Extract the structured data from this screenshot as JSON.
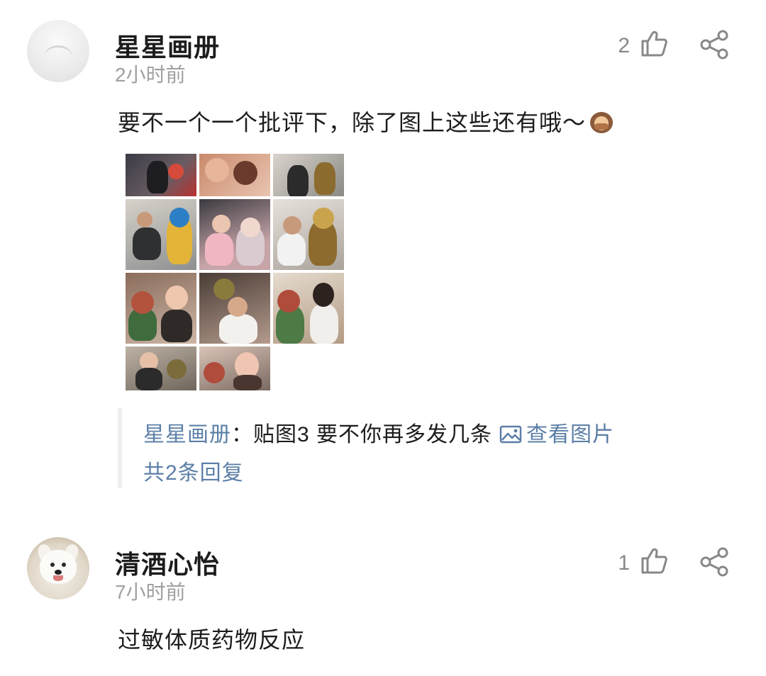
{
  "comments": [
    {
      "username": "星星画册",
      "time": "2小时前",
      "likes": "2",
      "text": "要不一个一个批评下，除了图上这些还有哦～",
      "emoji": "see-no-evil-monkey",
      "images": [
        {
          "icon": "photo-thumbnail"
        },
        {
          "icon": "photo-thumbnail"
        },
        {
          "icon": "photo-thumbnail"
        },
        {
          "icon": "photo-thumbnail"
        },
        {
          "icon": "photo-thumbnail"
        },
        {
          "icon": "photo-thumbnail"
        },
        {
          "icon": "photo-thumbnail"
        },
        {
          "icon": "photo-thumbnail"
        },
        {
          "icon": "photo-thumbnail"
        },
        {
          "icon": "photo-thumbnail"
        },
        {
          "icon": "photo-thumbnail"
        }
      ],
      "reply": {
        "author": "星星画册",
        "separator": "：",
        "text": "贴图3 要不你再多发几条",
        "view_image": "查看图片",
        "reply_count": "共2条回复"
      }
    },
    {
      "username": "清酒心怡",
      "time": "7小时前",
      "likes": "1",
      "text": "过敏体质药物反应"
    }
  ],
  "colors": {
    "link": "#5c7fa7",
    "muted": "#a0a0a0",
    "text": "#1c1c1c",
    "reply_border": "#eeeeee"
  }
}
